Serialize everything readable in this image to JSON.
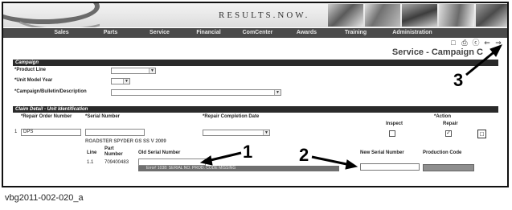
{
  "header": {
    "slogan": "RESULTS.NOW."
  },
  "nav": {
    "items": [
      "Sales",
      "Parts",
      "Service",
      "Financial",
      "ComCenter",
      "Awards",
      "Training",
      "Administration"
    ]
  },
  "toolbar": {
    "icons": [
      "new-document-icon",
      "print-icon",
      "help-icon",
      "back-icon",
      "forward-icon"
    ]
  },
  "page_title": "Service - Campaign C",
  "campaign": {
    "section_title": "Campaign",
    "product_line_label": "*Product Line",
    "unit_model_year_label": "*Unit Model Year",
    "campaign_label": "*Campaign/Bulletin/Description"
  },
  "claim": {
    "section_title": "Claim Detail - Unit Identification",
    "headers": {
      "repair_order": "*Repair Order Number",
      "serial_number": "*Serial Number",
      "repair_completion": "*Repair Completion Date",
      "action": "*Action",
      "inspect": "Inspect",
      "repair": "Repair"
    },
    "row_number": "1",
    "repair_order_value": "DPS",
    "unit_description": "ROADSTER SPYDER GS SS V 2009",
    "parts_table": {
      "col_line": "Line",
      "col_part_number": "Part Number",
      "col_old_serial": "Old Serial Number",
      "col_new_serial": "New Serial Number",
      "col_production_code": "Production Code",
      "line": "1.1",
      "part_number": "709400483"
    },
    "error_message": "Error! 1038: SERIAL NO. PROD. CODE MISSING"
  },
  "callouts": [
    "1",
    "2",
    "3"
  ],
  "caption": "vbg2011-002-020_a"
}
